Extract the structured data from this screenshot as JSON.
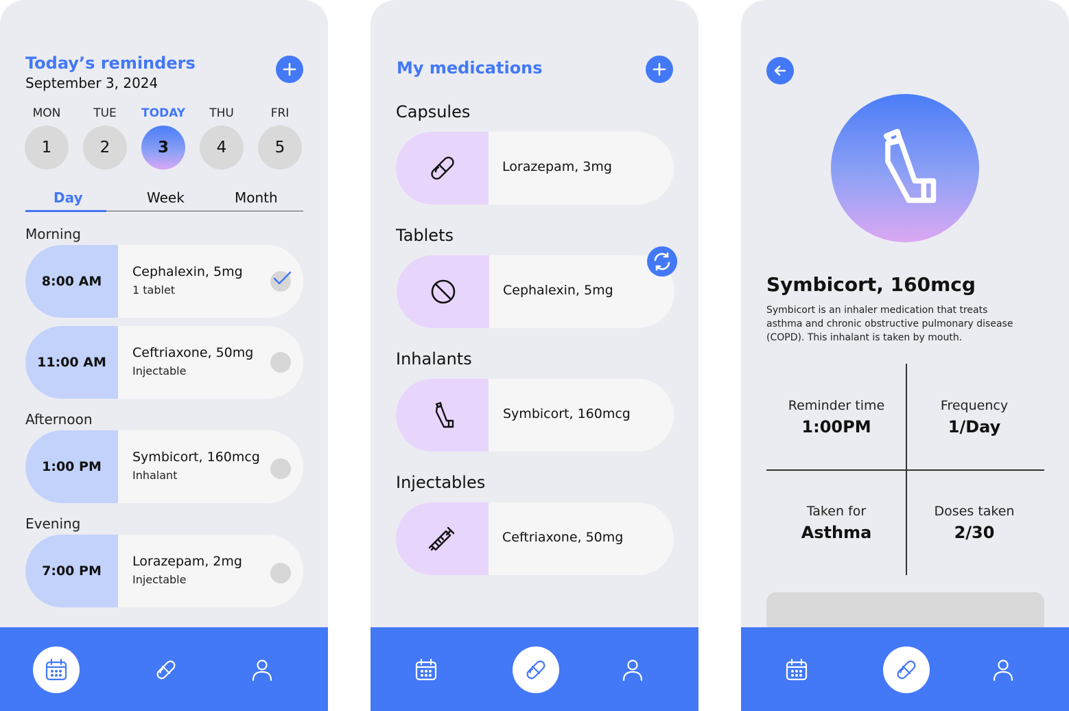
{
  "colors": {
    "accent": "#4378f6",
    "time_pill": "#c2d2fb",
    "icon_pill": "#e8d5fc",
    "screen_bg": "#ebecf2"
  },
  "reminders_screen": {
    "title": "Today’s reminders",
    "date": "September 3, 2024",
    "add_icon": "plus-icon",
    "days": [
      {
        "label": "MON",
        "num": "1"
      },
      {
        "label": "TUE",
        "num": "2"
      },
      {
        "label": "TODAY",
        "num": "3"
      },
      {
        "label": "THU",
        "num": "4"
      },
      {
        "label": "FRI",
        "num": "5"
      }
    ],
    "tabs": [
      "Day",
      "Week",
      "Month"
    ],
    "sections": [
      "Morning",
      "Afternoon",
      "Evening"
    ],
    "reminders": [
      {
        "time": "8:00 AM",
        "name": "Cephalexin, 5mg",
        "type": "1 tablet",
        "taken": true
      },
      {
        "time": "11:00 AM",
        "name": "Ceftriaxone, 50mg",
        "type": "Injectable",
        "taken": false
      },
      {
        "time": "1:00 PM",
        "name": "Symbicort, 160mcg",
        "type": "Inhalant",
        "taken": false
      },
      {
        "time": "7:00 PM",
        "name": "Lorazepam, 2mg",
        "type": "Injectable",
        "taken": false
      }
    ]
  },
  "medications_screen": {
    "title": "My medications",
    "categories": [
      {
        "label": "Capsules",
        "med": "Lorazepam, 3mg",
        "icon": "capsule-icon"
      },
      {
        "label": "Tablets",
        "med": "Cephalexin, 5mg",
        "icon": "tablet-icon"
      },
      {
        "label": "Inhalants",
        "med": "Symbicort, 160mcg",
        "icon": "inhaler-icon"
      },
      {
        "label": "Injectables",
        "med": "Ceftriaxone, 50mg",
        "icon": "syringe-icon"
      }
    ],
    "refresh_icon": "refresh-icon"
  },
  "detail_screen": {
    "name": "Symbicort, 160mcg",
    "description": "Symbicort is an inhaler medication that treats asthma and chronic obstructive pulmonary disease (COPD). This inhalant is taken by mouth.",
    "stats": [
      {
        "label": "Reminder time",
        "value": "1:00PM"
      },
      {
        "label": "Frequency",
        "value": "1/Day"
      },
      {
        "label": "Taken for",
        "value": "Asthma"
      },
      {
        "label": "Doses taken",
        "value": "2/30"
      }
    ]
  },
  "nav": {
    "items": [
      "calendar-icon",
      "pill-icon",
      "user-icon"
    ]
  }
}
